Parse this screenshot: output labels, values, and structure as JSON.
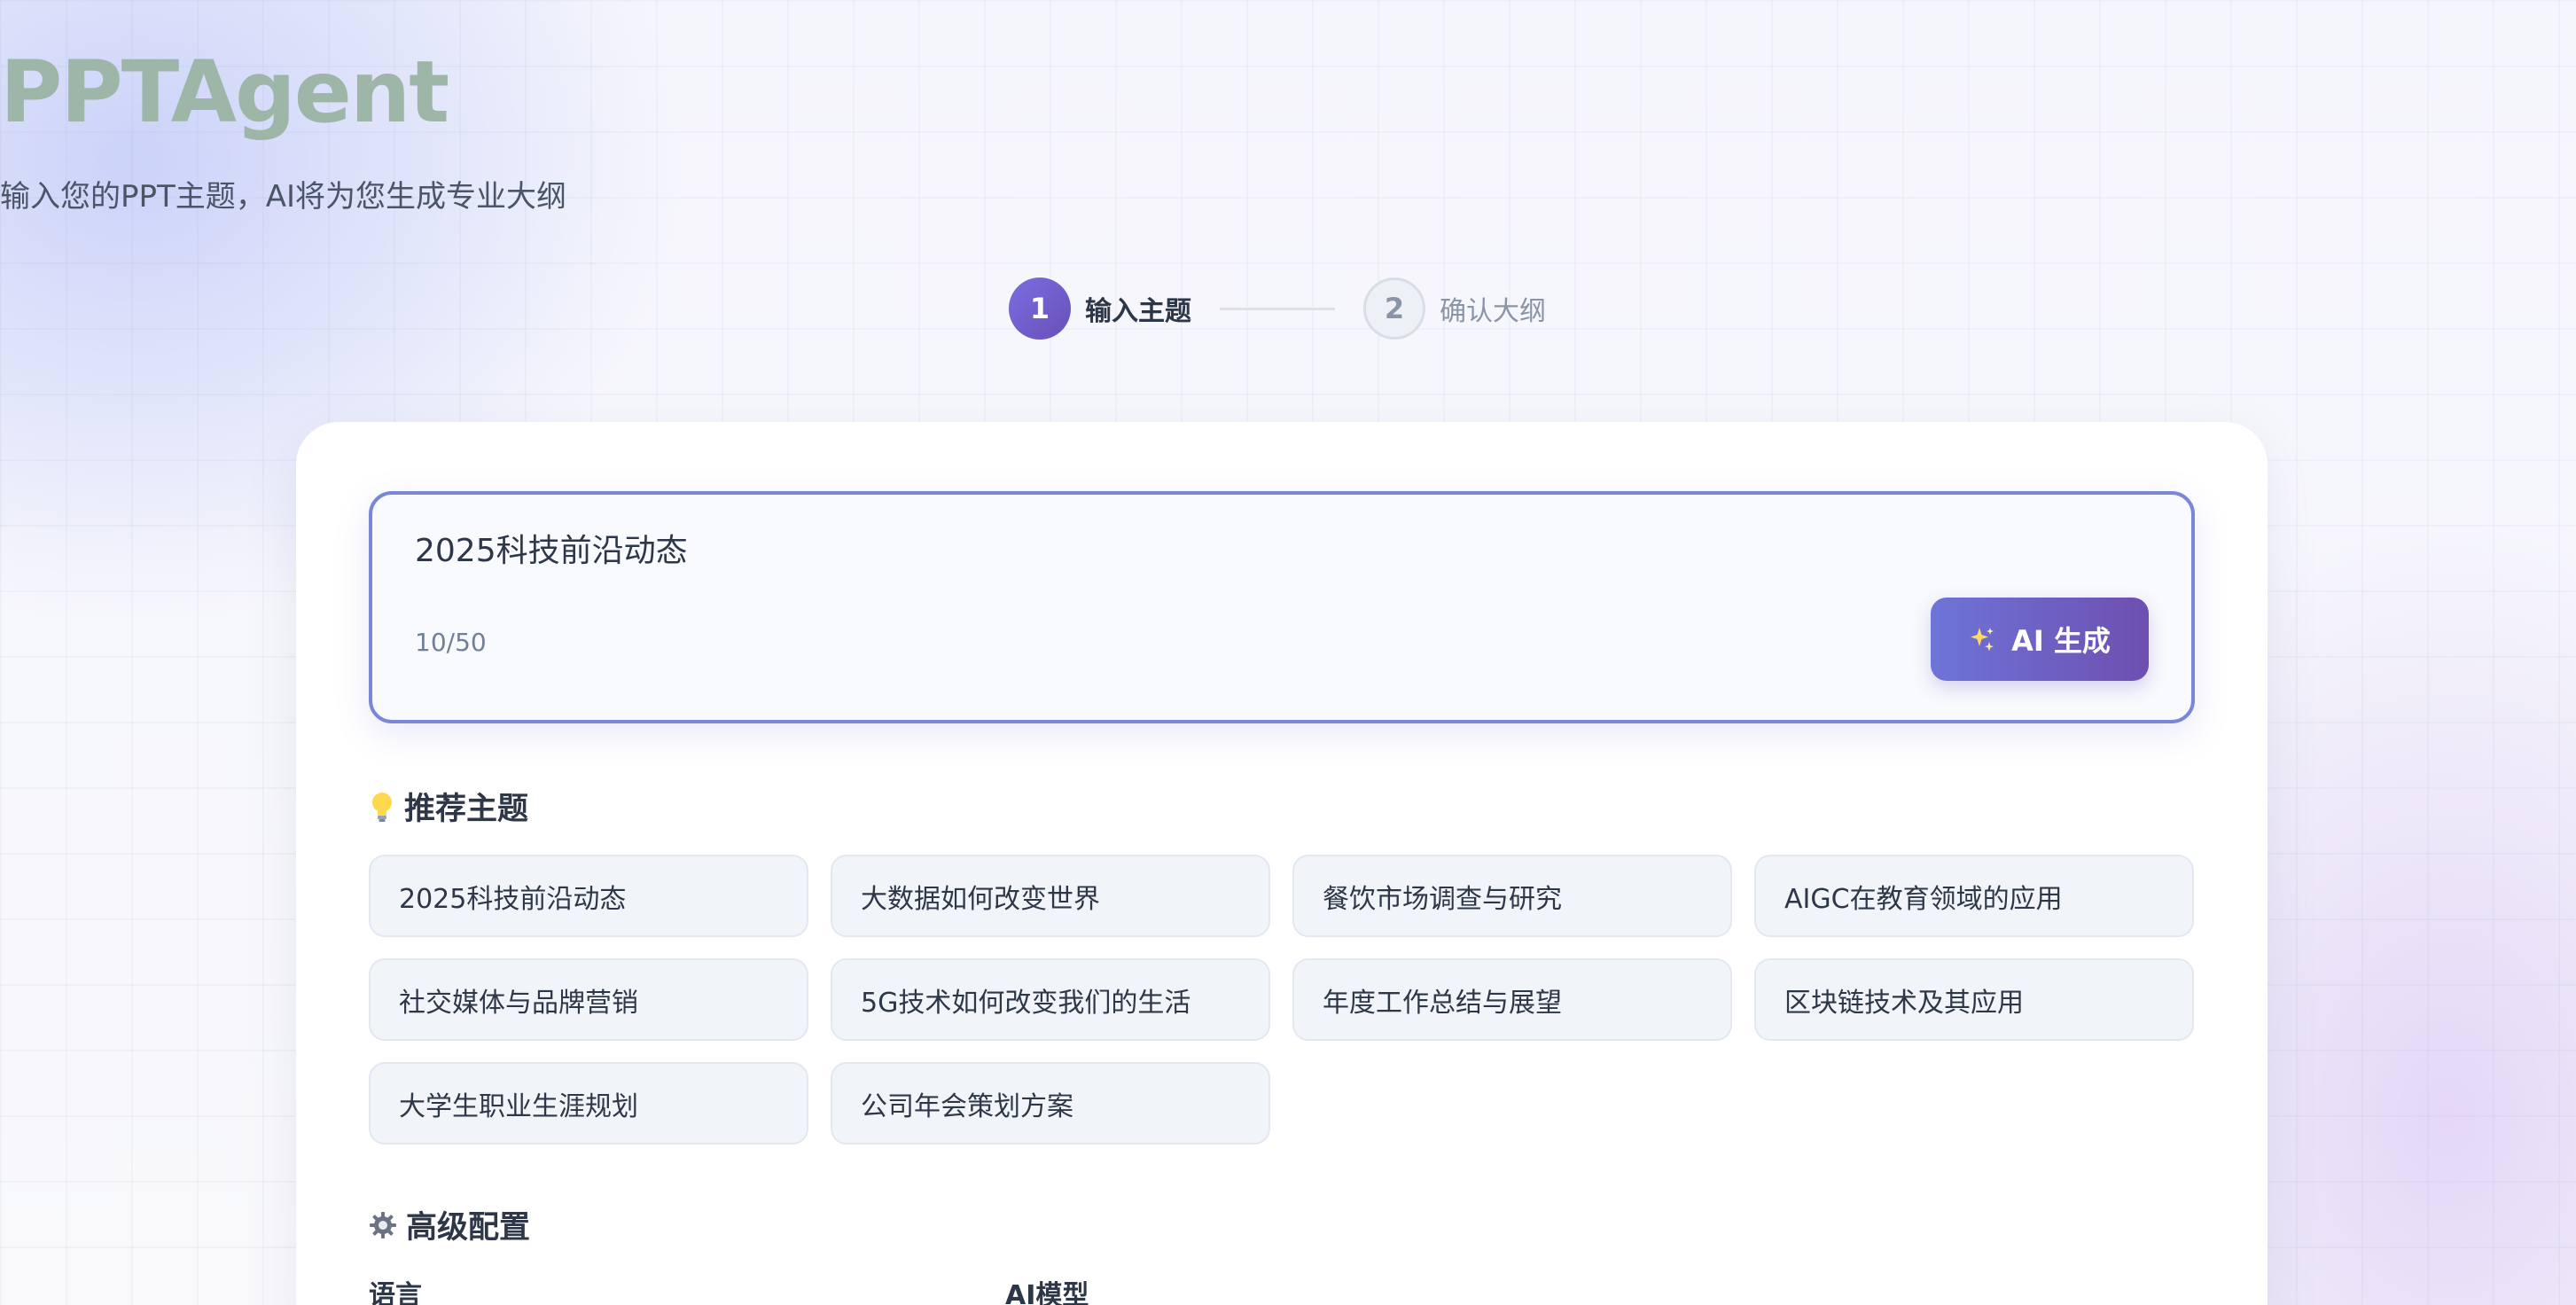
{
  "header": {
    "title": "PPTAgent",
    "subtitle": "输入您的PPT主题，AI将为您生成专业大纲"
  },
  "steps": [
    {
      "number": "1",
      "label": "输入主题",
      "state": "active"
    },
    {
      "number": "2",
      "label": "确认大纲",
      "state": "inactive"
    }
  ],
  "topic_input": {
    "value": "2025科技前沿动态",
    "counter": "10/50",
    "generate_icon": "sparkles-icon",
    "generate_label": "AI 生成"
  },
  "recommended": {
    "icon": "lightbulb-icon",
    "title": "推荐主题",
    "items": [
      "2025科技前沿动态",
      "大数据如何改变世界",
      "餐饮市场调查与研究",
      "AIGC在教育领域的应用",
      "社交媒体与品牌营销",
      "5G技术如何改变我们的生活",
      "年度工作总结与展望",
      "区块链技术及其应用",
      "大学生职业生涯规划",
      "公司年会策划方案"
    ]
  },
  "advanced": {
    "icon": "gear-icon",
    "title": "高级配置",
    "language_label": "语言",
    "model_label": "AI模型"
  },
  "colors": {
    "title": "#9db6a8",
    "accent_start": "#6e74d8",
    "accent_end": "#6e4fb0",
    "input_border": "#7a86d8"
  }
}
